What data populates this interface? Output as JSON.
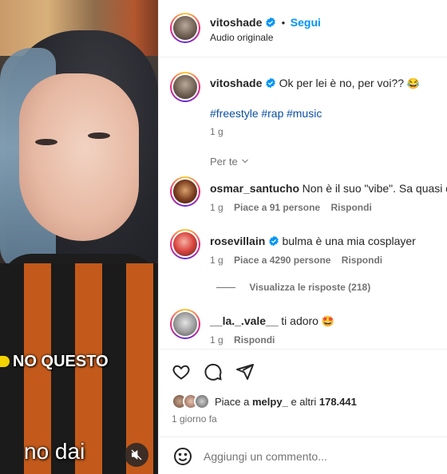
{
  "post": {
    "username": "vitoshade",
    "follow_label": "Segui",
    "audio": "Audio originale",
    "caption": "Ok per lei è no, per voi??",
    "caption_emoji": "😂",
    "hashtags": [
      "#freestyle",
      "#rap",
      "#music"
    ],
    "time": "1 g"
  },
  "video": {
    "caption_top": "NO QUESTO",
    "caption_bottom": "no dai",
    "mute_icon": "speaker-muted-icon"
  },
  "comments_section": {
    "sort_label": "Per te",
    "comments": [
      {
        "username": "osmar_santucho",
        "verified": false,
        "text": "Non è il suo \"vibe\". Sa quasi di",
        "time": "1 g",
        "likes": "Piace a 91 persone",
        "reply": "Rispondi"
      },
      {
        "username": "rosevillain",
        "verified": true,
        "text": "bulma è una mia cosplayer",
        "time": "1 g",
        "likes": "Piace a 4290 persone",
        "reply": "Rispondi"
      },
      {
        "username": "__la._.vale__",
        "verified": false,
        "text": "ti adoro",
        "emoji": "🤩",
        "time": "1 g",
        "reply": "Rispondi"
      }
    ],
    "view_replies": "Visualizza le risposte (218)"
  },
  "actions": {
    "icons": [
      "heart-icon",
      "comment-icon",
      "share-icon"
    ],
    "liked_by_prefix": "Piace a",
    "liked_by_user": "melpy_",
    "liked_by_suffix": "e altri",
    "liked_by_count": "178.441",
    "date": "1 giorno fa"
  },
  "add_comment": {
    "placeholder": "Aggiungi un commento..."
  },
  "colors": {
    "link_blue": "#0095f6",
    "verified_blue": "#0095f6",
    "hashtag": "#0a4fa3",
    "muted_text": "#737373"
  }
}
